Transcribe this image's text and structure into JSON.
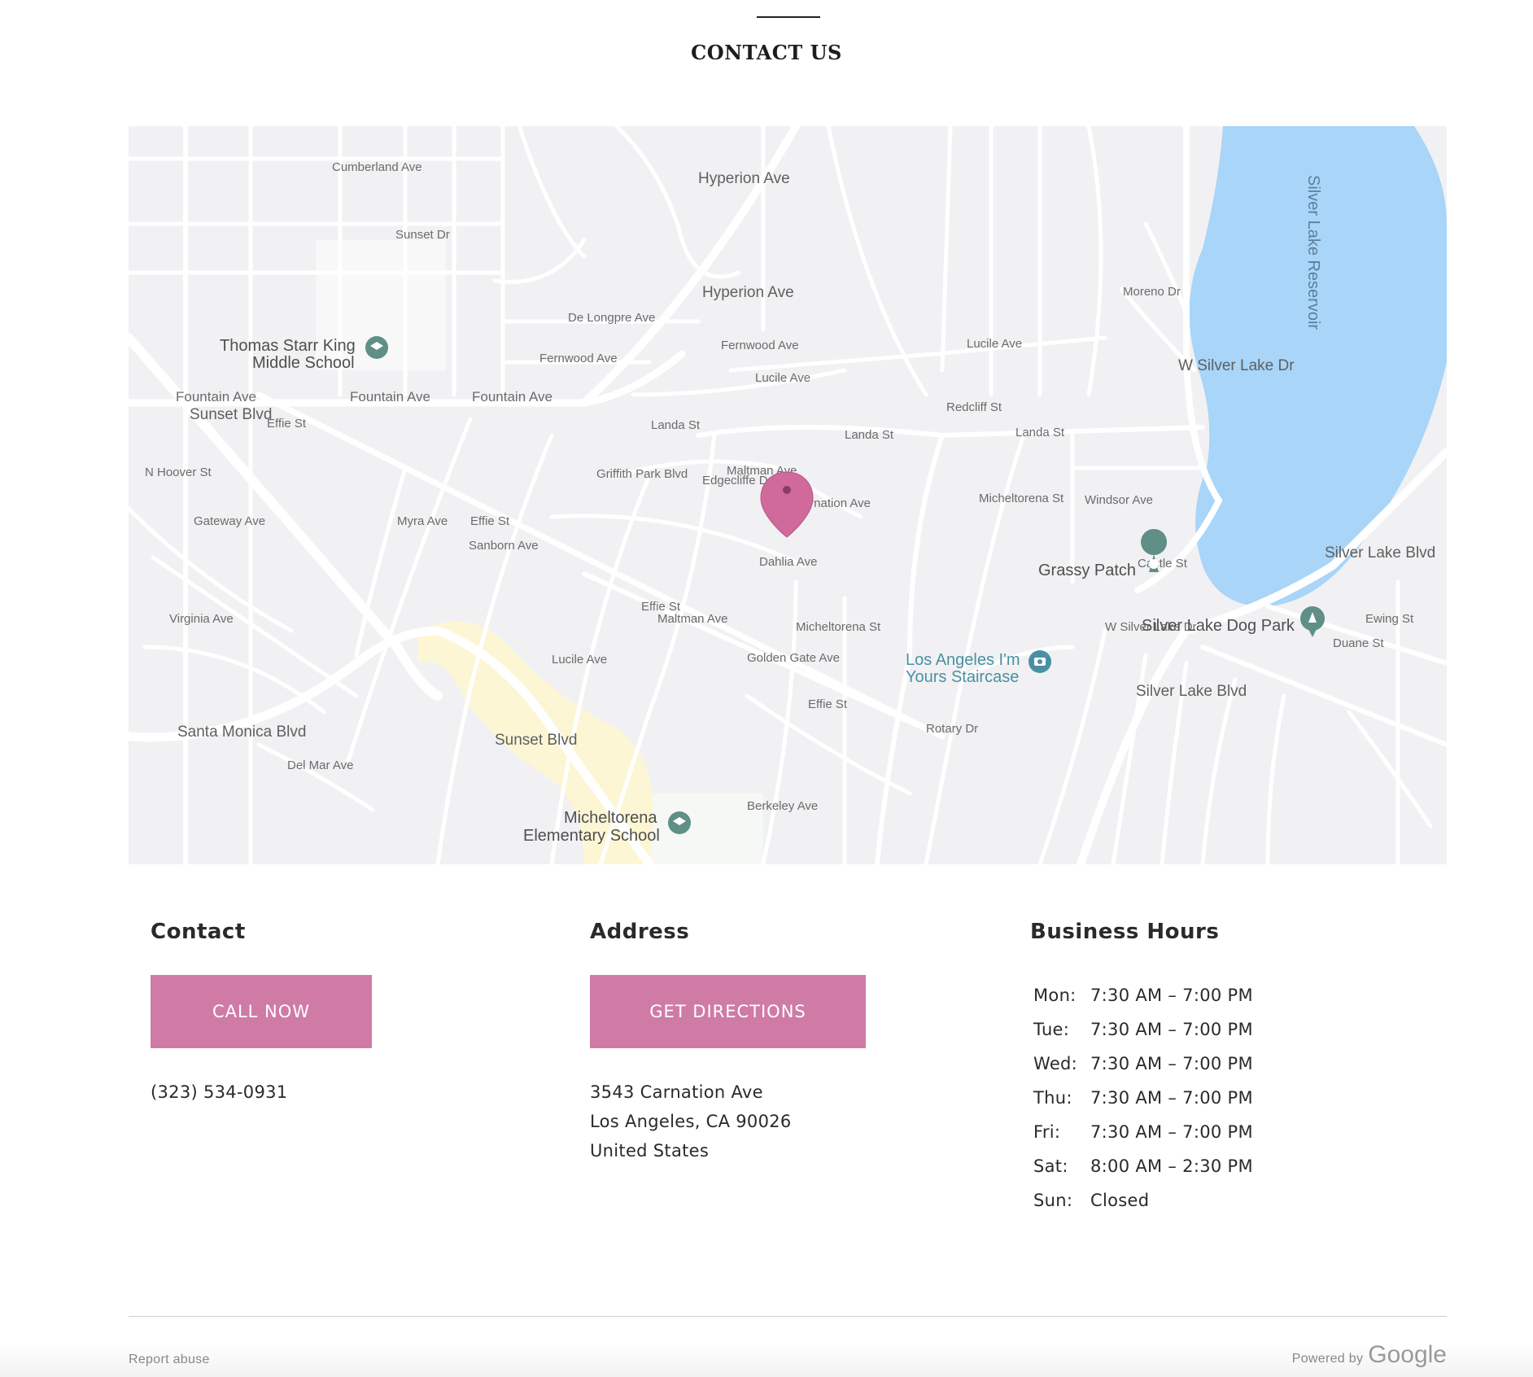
{
  "section": {
    "title": "CONTACT US"
  },
  "map": {
    "places": {
      "school1_line1": "Thomas Starr King",
      "school1_line2": "Middle School",
      "school2_line1": "Micheltorena",
      "school2_line2": "Elementary School",
      "grassy_patch": "Grassy Patch",
      "dog_park": "Silver Lake Dog Park",
      "staircase_line1": "Los Angeles I'm",
      "staircase_line2": "Yours Staircase",
      "reservoir": "Silver Lake Reservoir"
    },
    "streets": {
      "fountain1": "Fountain Ave",
      "fountain2": "Fountain Ave",
      "fountain3": "Fountain Ave",
      "hyperion1": "Hyperion Ave",
      "hyperion2": "Hyperion Ave",
      "sunset1": "Sunset Blvd",
      "sunset2": "Sunset Blvd",
      "santa_monica": "Santa Monica Blvd",
      "silver_lake_blvd1": "Silver Lake Blvd",
      "silver_lake_blvd2": "Silver Lake Blvd",
      "w_silver_lake_dr1": "W Silver Lake Dr",
      "w_silver_lake_dr2": "W Silver Lake Dr",
      "cumberland": "Cumberland Ave",
      "sunset_dr": "Sunset Dr",
      "landa1": "Landa St",
      "landa2": "Landa St",
      "landa3": "Landa St",
      "effie1": "Effie St",
      "effie2": "Effie St",
      "effie3": "Effie St",
      "effie4": "Effie St",
      "carnation": "Carnation Ave",
      "dahlia": "Dahlia Ave",
      "maltman1": "Maltman Ave",
      "maltman2": "Maltman Ave",
      "lucile1": "Lucile Ave",
      "lucile2": "Lucile Ave",
      "fernwood1": "Fernwood Ave",
      "fernwood2": "Fernwood Ave",
      "de_longpre": "De Longpre Ave",
      "windsor": "Windsor Ave",
      "micheltorena1": "Micheltorena St",
      "micheltorena2": "Micheltorena St",
      "griffith": "Griffith Park Blvd",
      "redcliff": "Redcliff St",
      "n_hoover": "N Hoover St",
      "virginia": "Virginia Ave",
      "gateway": "Gateway Ave",
      "golden_gate": "Golden Gate Ave",
      "berkeley": "Berkeley Ave",
      "duane": "Duane St",
      "ewing": "Ewing St",
      "rotary": "Rotary Dr",
      "edgecliffe": "Edgecliffe Dr",
      "myra": "Myra Ave",
      "sanborn": "Sanborn Ave",
      "del_mar": "Del Mar Ave",
      "moreno": "Moreno Dr",
      "castle": "Castle St"
    }
  },
  "contact": {
    "heading": "Contact",
    "button": "CALL NOW",
    "phone": "(323) 534-0931"
  },
  "address": {
    "heading": "Address",
    "button": "GET DIRECTIONS",
    "line1": "3543 Carnation Ave",
    "line2": "Los Angeles, CA 90026",
    "line3": "United States"
  },
  "hours": {
    "heading": "Business Hours",
    "rows": [
      {
        "day": "Mon:",
        "time": "7:30 AM – 7:00 PM"
      },
      {
        "day": "Tue:",
        "time": "7:30 AM – 7:00 PM"
      },
      {
        "day": "Wed:",
        "time": "7:30 AM – 7:00 PM"
      },
      {
        "day": "Thu:",
        "time": "7:30 AM – 7:00 PM"
      },
      {
        "day": "Fri:",
        "time": "7:30 AM – 7:00 PM"
      },
      {
        "day": "Sat:",
        "time": "8:00 AM – 2:30 PM"
      },
      {
        "day": "Sun:",
        "time": "Closed"
      }
    ]
  },
  "footer": {
    "report": "Report abuse",
    "powered_by": "Powered by",
    "google": "Google"
  },
  "colors": {
    "accent": "#cf7ba6",
    "water": "#a8d5f8",
    "map_bg": "#f1f1f3",
    "highway": "#fdf3c4",
    "poi": "#5f8f86"
  }
}
